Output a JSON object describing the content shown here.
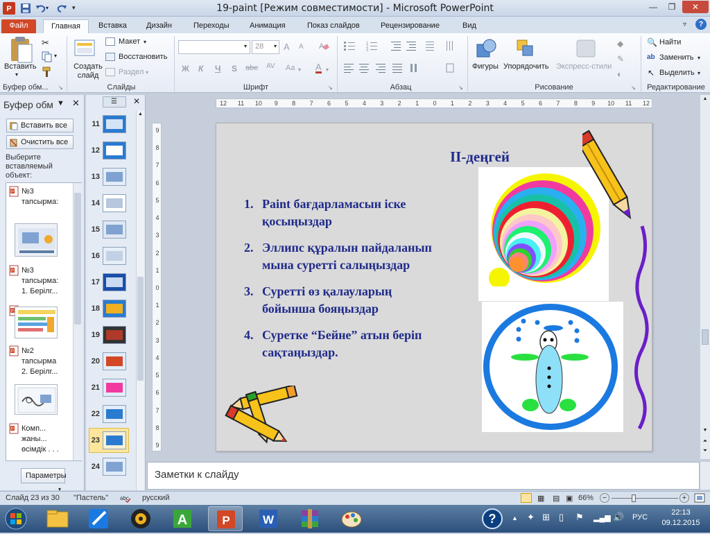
{
  "window": {
    "title": "19-paint [Режим совместимости] - Microsoft PowerPoint"
  },
  "tabs": [
    "Файл",
    "Главная",
    "Вставка",
    "Дизайн",
    "Переходы",
    "Анимация",
    "Показ слайдов",
    "Рецензирование",
    "Вид"
  ],
  "ribbon": {
    "clipboard": {
      "paste": "Вставить",
      "label": "Буфер обм..."
    },
    "slides": {
      "new_slide": "Создать слайд",
      "layout": "Макет",
      "reset": "Восстановить",
      "section": "Раздел",
      "label": "Слайды"
    },
    "font": {
      "size": "28",
      "label": "Шрифт",
      "bold": "Ж",
      "italic": "К",
      "underline": "Ч",
      "shadow": "S",
      "strike": "abe",
      "spacing": "AV",
      "case": "Aa",
      "color": "A",
      "grow": "A",
      "shrink": "A"
    },
    "paragraph": {
      "label": "Абзац"
    },
    "drawing": {
      "shapes": "Фигуры",
      "arrange": "Упорядочить",
      "quick_styles": "Экспресс-стили",
      "label": "Рисование"
    },
    "editing": {
      "find": "Найти",
      "replace": "Заменить",
      "select": "Выделить",
      "label": "Редактирование"
    }
  },
  "clipboard_pane": {
    "title": "Буфер обм",
    "paste_all": "Вставить все",
    "clear_all": "Очистить все",
    "prompt": "Выберите вставляемый объект:",
    "items": [
      {
        "lines": [
          "№3",
          "тапсырма:"
        ]
      },
      {
        "lines": [
          "№3",
          "тапсырма:",
          "1. Берілг..."
        ]
      },
      {
        "lines": [
          "№2",
          "тапсырма",
          "2. Берілг..."
        ]
      },
      {
        "lines": [
          "Комп...",
          "жаны...",
          "өсімдік . . ."
        ]
      }
    ],
    "options": "Параметры"
  },
  "thumbnails": [
    "11",
    "12",
    "13",
    "14",
    "15",
    "16",
    "17",
    "18",
    "19",
    "20",
    "21",
    "22",
    "23",
    "24"
  ],
  "selected_slide": "23",
  "ruler_h": [
    "12",
    "11",
    "10",
    "9",
    "8",
    "7",
    "6",
    "5",
    "4",
    "3",
    "2",
    "1",
    "0",
    "1",
    "2",
    "3",
    "4",
    "5",
    "6",
    "7",
    "8",
    "9",
    "10",
    "11",
    "12"
  ],
  "ruler_v": [
    "9",
    "8",
    "7",
    "6",
    "5",
    "4",
    "3",
    "2",
    "1",
    "0",
    "1",
    "2",
    "3",
    "4",
    "5",
    "6",
    "7",
    "8",
    "9"
  ],
  "slide": {
    "heading": "ІІ-деңгей",
    "items": [
      {
        "num": "1.",
        "lines": [
          "Paint бағдарламасын іске",
          "қосыңыздар"
        ]
      },
      {
        "num": "2.",
        "lines": [
          "Эллипс құралын пайдаланып",
          "мына суретті  салыңыздар"
        ]
      },
      {
        "num": "3.",
        "lines": [
          "Суретті  өз қалауларың",
          "бойынша бояңыздар"
        ]
      },
      {
        "num": "4.",
        "lines": [
          "Суретке  “Бейне” атын  беріп",
          "сақтаңыздар."
        ]
      }
    ]
  },
  "notes_placeholder": "Заметки к слайду",
  "status": {
    "slide_info": "Слайд 23 из 30",
    "theme": "\"Пастель\"",
    "language": "русский",
    "zoom": "66%"
  },
  "taskbar": {
    "lang": "РУС",
    "time": "22:13",
    "date": "09.12.2015"
  },
  "colors": {
    "accent_file": "#d24726",
    "slide_text": "#1f2a8a",
    "taskbar": "#2b4f7c"
  }
}
